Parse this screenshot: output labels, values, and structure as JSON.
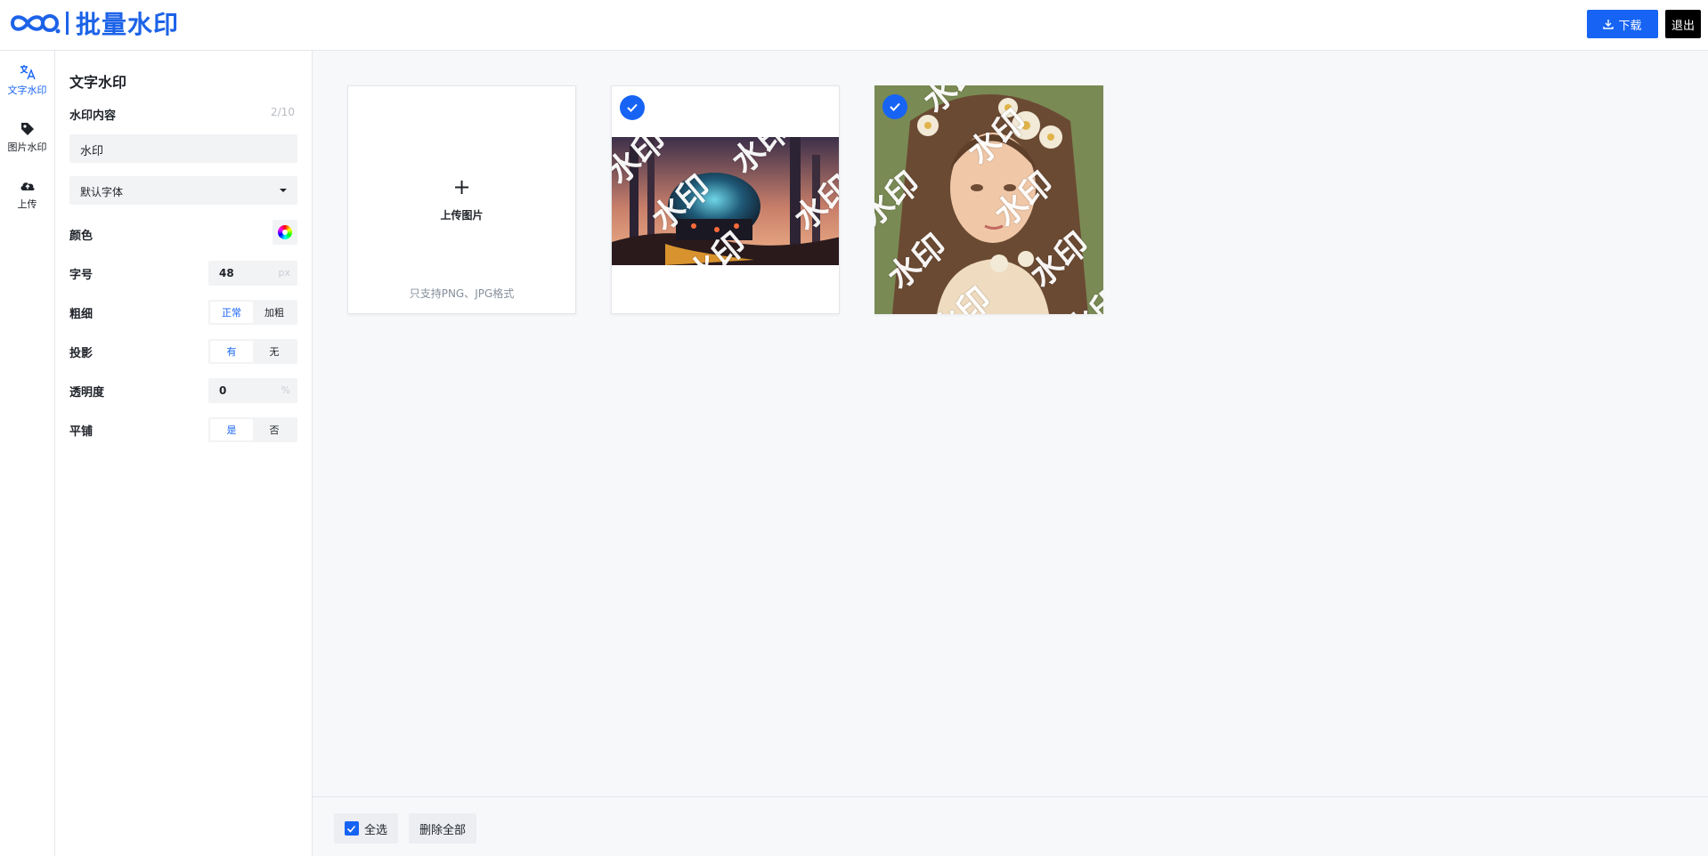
{
  "header": {
    "brand": "批量水印",
    "download_label": "下载",
    "logout_label": "退出",
    "accent_color": "#1764f4"
  },
  "rail": {
    "items": [
      {
        "label": "文字水印",
        "icon": "translate-icon",
        "active": true
      },
      {
        "label": "图片水印",
        "icon": "tag-icon",
        "active": false
      },
      {
        "label": "上传",
        "icon": "cloud-upload-icon",
        "active": false
      }
    ]
  },
  "panel": {
    "title": "文字水印",
    "content_label": "水印内容",
    "content_counter": "2/10",
    "content_value": "水印",
    "font_value": "默认字体",
    "color_label": "颜色",
    "size_label": "字号",
    "size_value": "48",
    "size_unit": "px",
    "weight_label": "粗细",
    "weight_options": [
      "正常",
      "加粗"
    ],
    "weight_selected": "正常",
    "shadow_label": "投影",
    "shadow_options": [
      "有",
      "无"
    ],
    "shadow_selected": "有",
    "opacity_label": "透明度",
    "opacity_value": "0",
    "opacity_unit": "%",
    "tile_label": "平铺",
    "tile_options": [
      "是",
      "否"
    ],
    "tile_selected": "是"
  },
  "gallery": {
    "upload_label": "上传图片",
    "upload_hint": "只支持PNG、JPG格式",
    "watermark_text": "水印",
    "images": [
      {
        "name": "sci-fi-scene",
        "selected": true
      },
      {
        "name": "portrait-girl",
        "selected": true
      }
    ]
  },
  "footer": {
    "select_all_label": "全选",
    "delete_all_label": "删除全部"
  }
}
